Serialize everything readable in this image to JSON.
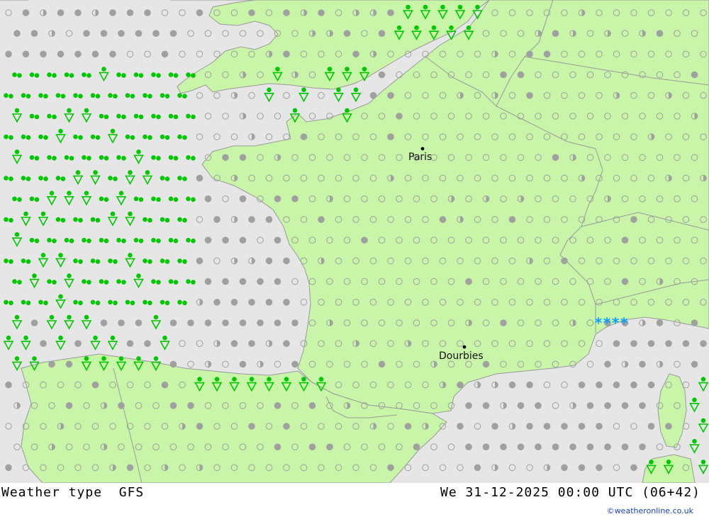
{
  "footer": {
    "product": "Weather type",
    "model": "GFS",
    "datetime": "We 31-12-2025 00:00 UTC (06+42)",
    "credit": "©weatheronline.co.uk"
  },
  "cities": [
    {
      "name": "Paris"
    },
    {
      "name": "Dourbies"
    }
  ],
  "colors": {
    "sea": "#e6e6e6",
    "land": "#c8f5a8",
    "border": "#9a9a9a",
    "symbol_grey": "#a0a0a0",
    "rain_green": "#00c800",
    "snow_blue": "#0aa0ff"
  },
  "symbols": {
    "snow_glyph": "****",
    "legend": [
      "clear",
      "partly cloudy",
      "cloudy",
      "drizzle",
      "rain showers",
      "snow"
    ]
  }
}
